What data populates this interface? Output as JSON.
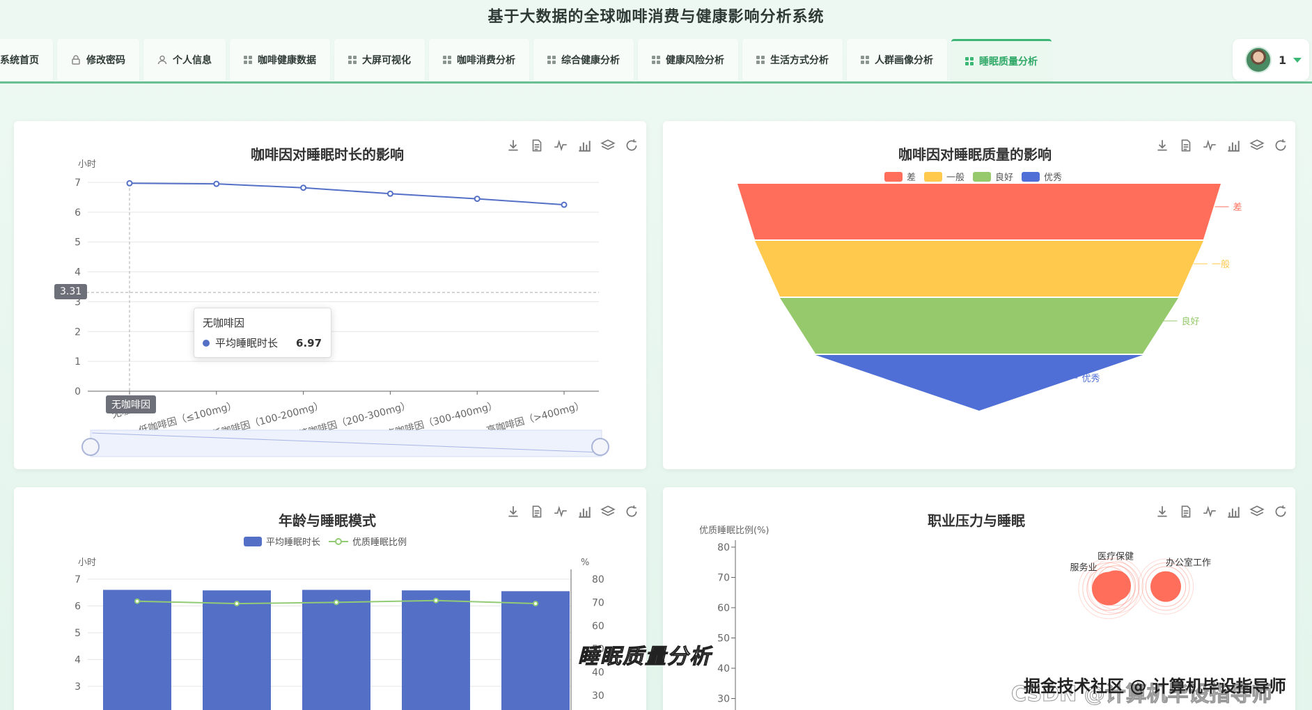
{
  "app": {
    "title": "基于大数据的全球咖啡消费与健康影响分析系统"
  },
  "nav": {
    "tabs": [
      {
        "label": "系统首页",
        "icon": "none"
      },
      {
        "label": "修改密码",
        "icon": "lock-icon"
      },
      {
        "label": "个人信息",
        "icon": "user-icon"
      },
      {
        "label": "咖啡健康数据",
        "icon": "grid-icon"
      },
      {
        "label": "大屏可视化",
        "icon": "grid-icon"
      },
      {
        "label": "咖啡消费分析",
        "icon": "grid-icon"
      },
      {
        "label": "综合健康分析",
        "icon": "grid-icon"
      },
      {
        "label": "健康风险分析",
        "icon": "grid-icon"
      },
      {
        "label": "生活方式分析",
        "icon": "grid-icon"
      },
      {
        "label": "人群画像分析",
        "icon": "grid-icon"
      },
      {
        "label": "睡眠质量分析",
        "icon": "grid-icon",
        "active": true
      }
    ]
  },
  "user": {
    "name": "1"
  },
  "colors": {
    "accent": "#3cb675",
    "blue": "#5470c6",
    "red": "#ff6e5a",
    "yellow": "#ffc94d",
    "green": "#95c96b"
  },
  "overlay": {
    "caption": "睡眠质量分析",
    "watermark": "掘金技术社区 @ 计算机毕设指导师",
    "watermark2": "CSDN @计算机毕设指导师"
  },
  "chart_data": [
    {
      "type": "line",
      "title": "咖啡因对睡眠时长的影响",
      "ylabel": "小时",
      "ylim": [
        0,
        7
      ],
      "yticks": [
        "0",
        "1",
        "2",
        "3",
        "4",
        "5",
        "6",
        "7"
      ],
      "categories": [
        "无咖啡因",
        "低咖啡因（≤100mg）",
        "中低咖啡因（100-200mg）",
        "中等咖啡因（200-300mg）",
        "中高咖啡因（300-400mg）",
        "高咖啡因（>400mg）"
      ],
      "series": [
        {
          "name": "平均睡眠时长",
          "values": [
            6.97,
            6.95,
            6.82,
            6.62,
            6.45,
            6.25
          ]
        }
      ],
      "pointer": {
        "y_value": "3.31",
        "x_label": "无咖啡因"
      },
      "tooltip": {
        "category": "无咖啡因",
        "series": "平均睡眠时长",
        "value": "6.97"
      }
    },
    {
      "type": "funnel",
      "title": "咖啡因对睡眠质量的影响",
      "legend": [
        "差",
        "一般",
        "良好",
        "优秀"
      ],
      "stages": [
        {
          "name": "差",
          "color": "#ff6e5a"
        },
        {
          "name": "一般",
          "color": "#ffc94d"
        },
        {
          "name": "良好",
          "color": "#95c96b"
        },
        {
          "name": "优秀",
          "color": "#4f6fd6"
        }
      ]
    },
    {
      "type": "bar",
      "title": "年龄与睡眠模式",
      "ylabel": "小时",
      "y2label": "%",
      "legend": [
        "平均睡眠时长",
        "优质睡眠比例"
      ],
      "ylim": [
        0,
        7
      ],
      "yticks": [
        "3",
        "4",
        "5",
        "6",
        "7"
      ],
      "y2ticks": [
        "30",
        "40",
        "50",
        "60",
        "70",
        "80"
      ],
      "series": [
        {
          "name": "平均睡眠时长",
          "values": [
            6.6,
            6.58,
            6.6,
            6.58,
            6.55
          ]
        },
        {
          "name": "优质睡眠比例",
          "values": [
            70.5,
            69.5,
            70,
            70.8,
            69.5
          ]
        }
      ]
    },
    {
      "type": "scatter",
      "title": "职业压力与睡眠",
      "ylabel": "优质睡眠比例(%)",
      "yticks": [
        "30",
        "40",
        "50",
        "60",
        "70",
        "80"
      ],
      "points": [
        {
          "label": "服务业",
          "value": 69.5
        },
        {
          "label": "医疗保健",
          "value": 70.5
        },
        {
          "label": "办公室工作",
          "value": 70.2
        }
      ]
    }
  ]
}
